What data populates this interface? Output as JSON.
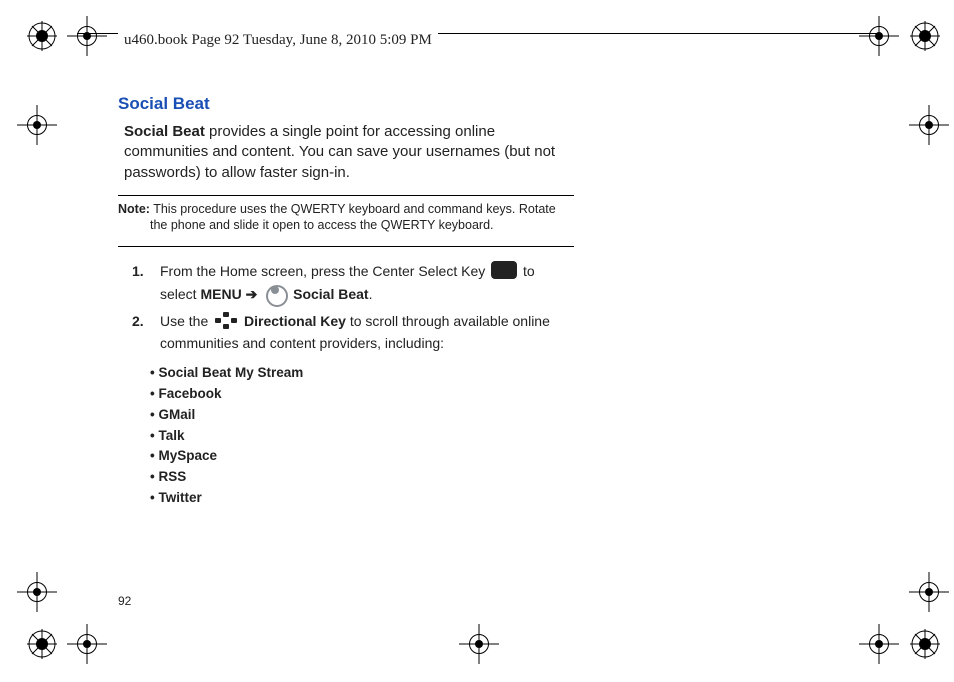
{
  "header_line": "u460.book  Page 92  Tuesday, June 8, 2010  5:09 PM",
  "section_title": "Social Beat",
  "intro": {
    "bold": "Social Beat",
    "rest": " provides a single point for accessing online communities and content. You can save your usernames (but not passwords) to allow faster sign-in."
  },
  "note": {
    "label": "Note:",
    "line1": " This procedure uses the QWERTY keyboard and command keys. Rotate",
    "line2": "the phone and slide it open to access the QWERTY keyboard."
  },
  "steps": [
    {
      "num": "1.",
      "pre": "From the Home screen, press the Center Select Key ",
      "mid1": " to select ",
      "menu": "MENU",
      "arrow": " ➔ ",
      "app": " Social Beat",
      "post": "."
    },
    {
      "num": "2.",
      "pre": "Use the ",
      "dir": " Directional Key",
      "post": " to scroll through available online communities and content providers, including:"
    }
  ],
  "providers": [
    "Social Beat My Stream",
    "Facebook",
    "GMail",
    "Talk",
    "MySpace",
    "RSS",
    "Twitter"
  ],
  "page_number": "92"
}
